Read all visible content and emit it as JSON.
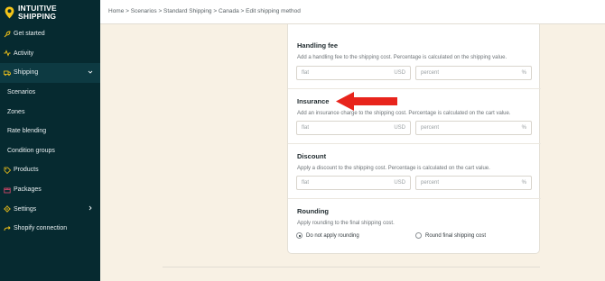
{
  "brand": {
    "line1": "INTUITIVE",
    "line2": "SHIPPING"
  },
  "breadcrumb": "Home > Scenarios > Standard Shipping > Canada > Edit shipping method",
  "nav": {
    "get_started": "Get started",
    "activity": "Activity",
    "shipping": "Shipping",
    "scenarios": "Scenarios",
    "zones": "Zones",
    "rate_blending": "Rate blending",
    "condition_groups": "Condition groups",
    "products": "Products",
    "packages": "Packages",
    "settings": "Settings",
    "shopify_connection": "Shopify connection"
  },
  "handling_fee": {
    "title": "Handling fee",
    "description": "Add a handling fee to the shipping cost. Percentage is calculated on the shipping value.",
    "flat_placeholder": "flat",
    "flat_suffix": "USD",
    "percent_placeholder": "percent",
    "percent_suffix": "%"
  },
  "insurance": {
    "title": "Insurance",
    "description": "Add an insurance charge to the shipping cost. Percentage is calculated on the cart value.",
    "flat_placeholder": "flat",
    "flat_suffix": "USD",
    "percent_placeholder": "percent",
    "percent_suffix": "%"
  },
  "discount": {
    "title": "Discount",
    "description": "Apply a discount to the shipping cost. Percentage is calculated on the cart value.",
    "flat_placeholder": "flat",
    "flat_suffix": "USD",
    "percent_placeholder": "percent",
    "percent_suffix": "%"
  },
  "rounding": {
    "title": "Rounding",
    "description": "Apply rounding to the final shipping cost.",
    "option_no_rounding": "Do not apply rounding",
    "option_round": "Round final shipping cost",
    "selected": "Do not apply rounding"
  },
  "colors": {
    "sidebar": "#062a30",
    "accent": "#f5c518",
    "arrow": "#e8241c",
    "page_bg": "#f8f1e4"
  },
  "icons": [
    "map-pin-icon",
    "rocket-icon",
    "activity-icon",
    "truck-icon",
    "chevron-down-icon",
    "tag-icon",
    "package-icon",
    "gear-icon",
    "chevron-right-icon",
    "connection-icon"
  ]
}
